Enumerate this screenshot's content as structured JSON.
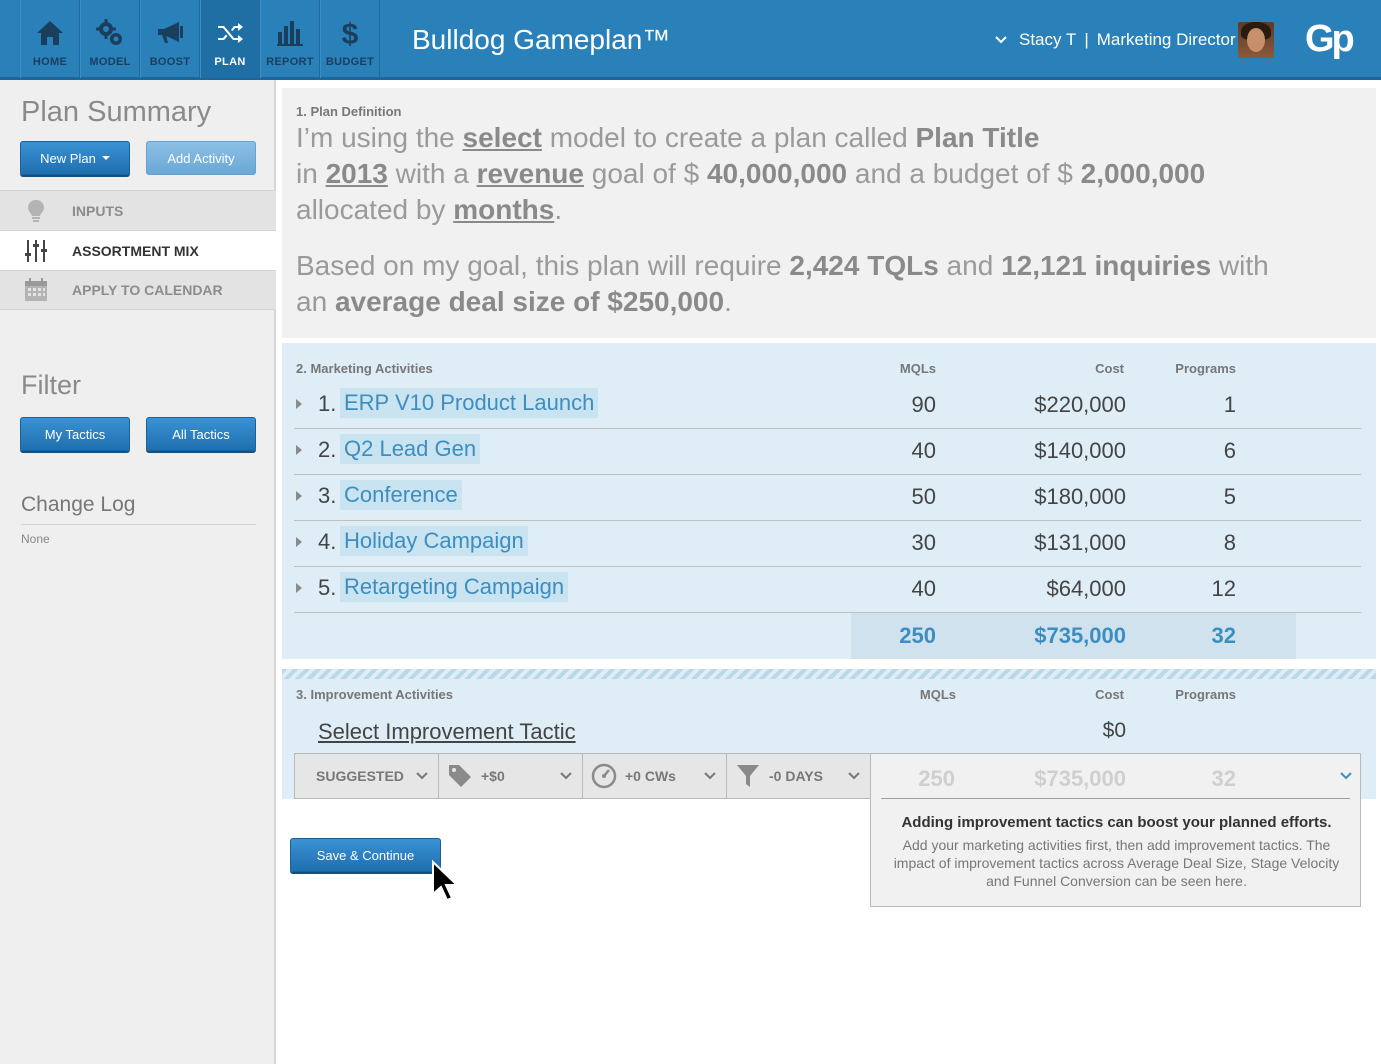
{
  "app": {
    "title": "Bulldog Gameplan™",
    "logo": "Gp"
  },
  "nav": [
    {
      "label": "HOME",
      "icon": "home-icon"
    },
    {
      "label": "MODEL",
      "icon": "gears-icon"
    },
    {
      "label": "BOOST",
      "icon": "megaphone-icon"
    },
    {
      "label": "PLAN",
      "icon": "shuffle-icon",
      "active": true
    },
    {
      "label": "REPORT",
      "icon": "bar-chart-icon"
    },
    {
      "label": "BUDGET",
      "icon": "dollar-icon"
    }
  ],
  "user": {
    "name": "Stacy T",
    "separator": "|",
    "role": "Marketing Director"
  },
  "sidebar": {
    "title": "Plan Summary",
    "new_plan": "New Plan",
    "add_activity": "Add Activity",
    "menu": [
      {
        "label": "INPUTS",
        "icon": "lightbulb-icon"
      },
      {
        "label": "ASSORTMENT MIX",
        "icon": "sliders-icon",
        "active": true
      },
      {
        "label": "APPLY TO CALENDAR",
        "icon": "calendar-icon"
      }
    ],
    "filter_title": "Filter",
    "my_tactics": "My Tactics",
    "all_tactics": "All Tactics",
    "changelog_title": "Change Log",
    "changelog_value": "None"
  },
  "definition": {
    "label": "1. Plan Definition",
    "l1_a": "I’m using the ",
    "model": "select",
    "l1_b": " model to create a plan called ",
    "plan_title": "Plan Title",
    "l2_a": "in ",
    "year": "2013",
    "l2_b": " with a ",
    "goal_type": "revenue",
    "l2_c": " goal of $ ",
    "goal": "40,000,000",
    "l2_d": " and a budget of $ ",
    "budget": "2,000,000",
    "l3_a": "allocated by ",
    "allocation": "months",
    "l3_b": ".",
    "l4_a": "Based on my goal, this plan will require ",
    "tqls": "2,424 TQLs",
    "l4_b": " and ",
    "inquiries": "12,121 inquiries",
    "l4_c": " with",
    "l5_a": "an ",
    "deal": "average deal size of $250,000",
    "l5_b": "."
  },
  "activities": {
    "label": "2. Marketing Activities",
    "col_mqls": "MQLs",
    "col_cost": "Cost",
    "col_programs": "Programs",
    "rows": [
      {
        "num": "1.",
        "name": "ERP V10 Product Launch",
        "mqls": "90",
        "cost": "$220,000",
        "programs": "1"
      },
      {
        "num": "2.",
        "name": "Q2 Lead Gen",
        "mqls": "40",
        "cost": "$140,000",
        "programs": "6"
      },
      {
        "num": "3.",
        "name": "Conference",
        "mqls": "50",
        "cost": "$180,000",
        "programs": "5"
      },
      {
        "num": "4.",
        "name": "Holiday Campaign",
        "mqls": "30",
        "cost": "$131,000",
        "programs": "8"
      },
      {
        "num": "5.",
        "name": "Retargeting Campaign",
        "mqls": "40",
        "cost": "$64,000",
        "programs": "12"
      }
    ],
    "totals": {
      "mqls": "250",
      "cost": "$735,000",
      "programs": "32"
    }
  },
  "improvement": {
    "label": "3. Improvement Activities",
    "col_mqls": "MQLs",
    "col_cost": "Cost",
    "col_programs": "Programs",
    "select_label": "Select Improvement Tactic",
    "cost": "$0",
    "controls": [
      {
        "label": "SUGGESTED",
        "icon": ""
      },
      {
        "label": "+$0",
        "icon": "tag-icon"
      },
      {
        "label": "+0 CWs",
        "icon": "speedometer-icon"
      },
      {
        "label": "-0 DAYS",
        "icon": "funnel-icon"
      }
    ],
    "panel": {
      "mqls": "250",
      "cost": "$735,000",
      "programs": "32",
      "heading": "Adding improvement tactics can boost your planned efforts.",
      "body": "Add your marketing activities first, then add improvement tactics. The impact of improvement tactics across Average Deal Size, Stage Velocity and Funnel Conversion can be seen here."
    }
  },
  "save_button": "Save & Continue"
}
